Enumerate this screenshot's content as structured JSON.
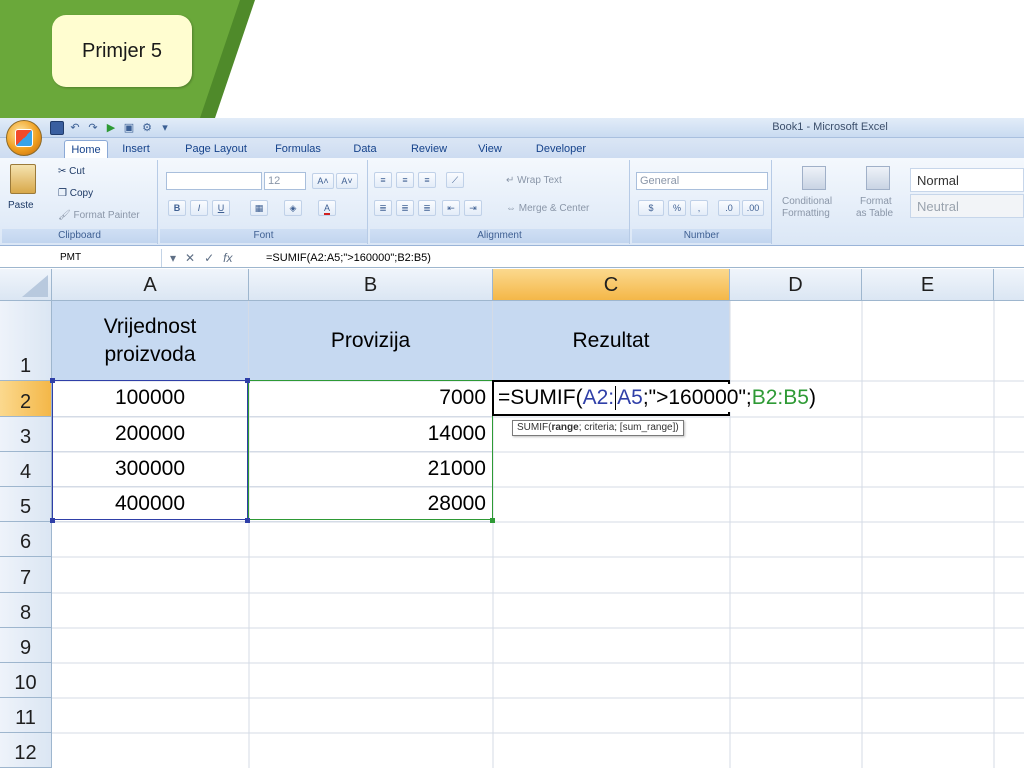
{
  "slide": {
    "title": "Primjer 5",
    "accent_color": "#4f8a2a"
  },
  "window": {
    "title": "Book1 - Microsoft Excel"
  },
  "ribbon": {
    "tabs": [
      "Home",
      "Insert",
      "Page Layout",
      "Formulas",
      "Data",
      "Review",
      "View",
      "Developer"
    ],
    "clipboard": {
      "paste": "Paste",
      "cut": "Cut",
      "copy": "Copy",
      "format_painter": "Format Painter",
      "label": "Clipboard"
    },
    "font": {
      "size": "12",
      "label": "Font"
    },
    "alignment": {
      "wrap_text": "Wrap Text",
      "merge_center": "Merge & Center",
      "label": "Alignment"
    },
    "number": {
      "format": "General",
      "label": "Number"
    },
    "styles": {
      "conditional": "Conditional",
      "formatting": "Formatting",
      "format": "Format",
      "as_table": "as Table",
      "normal": "Normal",
      "neutral": "Neutral"
    }
  },
  "formula_bar": {
    "name_box": "PMT",
    "formula": "=SUMIF(A2:A5;\">160000\";B2:B5)"
  },
  "columns": [
    "A",
    "B",
    "C",
    "D",
    "E"
  ],
  "rows": [
    "1",
    "2",
    "3",
    "4",
    "5",
    "6",
    "7",
    "8",
    "9",
    "10",
    "11",
    "12"
  ],
  "table": {
    "header_a_line1": "Vrijednost",
    "header_a_line2": "proizvoda",
    "header_b": "Provizija",
    "header_c": "Rezultat",
    "col_a": [
      "100000",
      "200000",
      "300000",
      "400000"
    ],
    "col_b": [
      "7000",
      "14000",
      "21000",
      "28000"
    ]
  },
  "editing": {
    "part1": "=SUMIF(",
    "ref_a1": "A2:",
    "ref_a2": "A5",
    "part2": ";\">160000\";",
    "ref_b": "B2:B5",
    "part3": ")",
    "tooltip_fn": "SUMIF(",
    "tooltip_range": "range",
    "tooltip_rest": "; criteria; [sum_range])"
  }
}
